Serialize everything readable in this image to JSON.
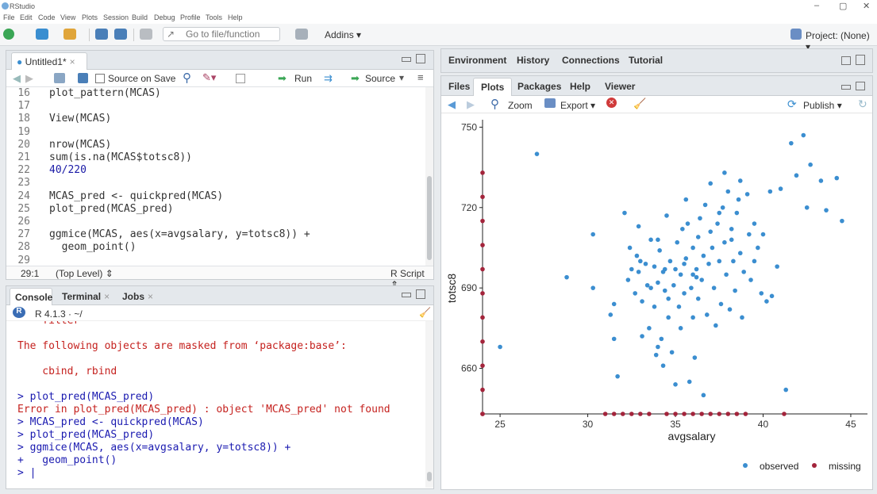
{
  "window": {
    "title": "RStudio",
    "minimize": "–",
    "maximize": "▢",
    "close": "✕"
  },
  "menu": [
    "File",
    "Edit",
    "Code",
    "View",
    "Plots",
    "Session",
    "Build",
    "Debug",
    "Profile",
    "Tools",
    "Help"
  ],
  "toolbar": {
    "goto_placeholder": "Go to file/function",
    "addins": "Addins ▾",
    "project": "Project: (None) ▾"
  },
  "editor": {
    "tab_label": "Untitled1*",
    "source_on_save": "Source on Save",
    "run_label": "Run",
    "source_label": "Source",
    "lines": [
      {
        "n": "16",
        "t": "plot_pattern(MCAS)"
      },
      {
        "n": "17",
        "t": ""
      },
      {
        "n": "18",
        "t": "View(MCAS)"
      },
      {
        "n": "19",
        "t": ""
      },
      {
        "n": "20",
        "t": "nrow(MCAS)"
      },
      {
        "n": "21",
        "t": "sum(is.na(MCAS$totsc8))"
      },
      {
        "n": "22",
        "t": "40/220"
      },
      {
        "n": "23",
        "t": ""
      },
      {
        "n": "24",
        "t": "MCAS_pred <- quickpred(MCAS)"
      },
      {
        "n": "25",
        "t": "plot_pred(MCAS_pred)"
      },
      {
        "n": "26",
        "t": ""
      },
      {
        "n": "27",
        "t": "ggmice(MCAS, aes(x=avgsalary, y=totsc8)) +"
      },
      {
        "n": "28",
        "t": "  geom_point()"
      },
      {
        "n": "29",
        "t": ""
      }
    ],
    "status_pos": "29:1",
    "status_scope": "(Top Level) ⇕",
    "status_type": "R Script ⇕"
  },
  "console": {
    "tabs": [
      "Console",
      "Terminal",
      "Jobs"
    ],
    "version": "R 4.1.3 · ~/",
    "lines": [
      {
        "t": "    filter",
        "c": "c-red"
      },
      {
        "t": "",
        "c": ""
      },
      {
        "t": "The following objects are masked from ‘package:base’:",
        "c": "c-red"
      },
      {
        "t": "",
        "c": ""
      },
      {
        "t": "    cbind, rbind",
        "c": "c-red"
      },
      {
        "t": "",
        "c": ""
      },
      {
        "t": "> plot_pred(MCAS_pred)",
        "c": "c-blue"
      },
      {
        "t": "Error in plot_pred(MCAS_pred) : object 'MCAS_pred' not found",
        "c": "c-red"
      },
      {
        "t": "> MCAS_pred <- quickpred(MCAS)",
        "c": "c-blue"
      },
      {
        "t": "> plot_pred(MCAS_pred)",
        "c": "c-blue"
      },
      {
        "t": "> ggmice(MCAS, aes(x=avgsalary, y=totsc8)) +",
        "c": "c-blue"
      },
      {
        "t": "+   geom_point()",
        "c": "c-blue"
      },
      {
        "t": "> |",
        "c": "c-blue"
      }
    ]
  },
  "env_tabs": [
    "Environment",
    "History",
    "Connections",
    "Tutorial"
  ],
  "files_tabs": [
    "Files",
    "Plots",
    "Packages",
    "Help",
    "Viewer"
  ],
  "plots_toolbar": {
    "zoom": "Zoom",
    "export": "Export ▾",
    "publish": "Publish ▾"
  },
  "colors": {
    "observed": "#3b8ed0",
    "missing": "#a3243b"
  },
  "chart_data": {
    "type": "scatter",
    "xlabel": "avgsalary",
    "ylabel": "totsc8",
    "xlim": [
      24,
      45.5
    ],
    "ylim": [
      643,
      751
    ],
    "x_ticks": [
      25,
      30,
      35,
      40,
      45
    ],
    "y_ticks": [
      660,
      690,
      720,
      750
    ],
    "legend": [
      {
        "name": "observed",
        "color": "#3b8ed0"
      },
      {
        "name": "missing",
        "color": "#a3243b"
      }
    ],
    "legend_position": "bottom-right",
    "observed": [
      [
        25,
        668
      ],
      [
        27.1,
        740
      ],
      [
        28.8,
        694
      ],
      [
        30.3,
        710
      ],
      [
        30.3,
        690
      ],
      [
        31.3,
        680
      ],
      [
        31.5,
        671
      ],
      [
        31.7,
        657
      ],
      [
        32.1,
        718
      ],
      [
        32.3,
        693
      ],
      [
        32.5,
        697
      ],
      [
        32.7,
        688
      ],
      [
        32.8,
        702
      ],
      [
        32.9,
        713
      ],
      [
        32.9,
        696
      ],
      [
        33.1,
        672
      ],
      [
        33.1,
        685
      ],
      [
        33.3,
        699
      ],
      [
        33.4,
        691
      ],
      [
        33.5,
        675
      ],
      [
        33.6,
        708
      ],
      [
        33.8,
        683
      ],
      [
        33.8,
        698
      ],
      [
        33.9,
        665
      ],
      [
        34,
        668
      ],
      [
        34,
        692
      ],
      [
        34.1,
        704
      ],
      [
        34.2,
        671
      ],
      [
        34.3,
        661
      ],
      [
        34.3,
        696
      ],
      [
        34.4,
        689
      ],
      [
        34.5,
        717
      ],
      [
        34.6,
        679
      ],
      [
        34.6,
        686
      ],
      [
        34.7,
        700
      ],
      [
        34.8,
        666
      ],
      [
        34.9,
        691
      ],
      [
        35,
        697
      ],
      [
        35,
        654
      ],
      [
        35.1,
        707
      ],
      [
        35.2,
        683
      ],
      [
        35.3,
        675
      ],
      [
        35.3,
        695
      ],
      [
        35.4,
        712
      ],
      [
        35.5,
        688
      ],
      [
        35.5,
        699
      ],
      [
        35.6,
        701
      ],
      [
        35.7,
        714
      ],
      [
        35.8,
        655
      ],
      [
        35.9,
        690
      ],
      [
        36,
        705
      ],
      [
        36,
        679
      ],
      [
        36.1,
        664
      ],
      [
        36.2,
        697
      ],
      [
        36.3,
        709
      ],
      [
        36.3,
        686
      ],
      [
        36.4,
        716
      ],
      [
        36.5,
        693
      ],
      [
        36.6,
        650
      ],
      [
        36.6,
        702
      ],
      [
        36.7,
        721
      ],
      [
        36.8,
        680
      ],
      [
        36.9,
        699
      ],
      [
        37,
        711
      ],
      [
        37,
        729
      ],
      [
        37.1,
        705
      ],
      [
        37.2,
        690
      ],
      [
        37.3,
        676
      ],
      [
        37.4,
        714
      ],
      [
        37.5,
        700
      ],
      [
        37.6,
        684
      ],
      [
        37.7,
        720
      ],
      [
        37.8,
        707
      ],
      [
        37.9,
        695
      ],
      [
        38,
        726
      ],
      [
        38.1,
        682
      ],
      [
        38.2,
        712
      ],
      [
        38.3,
        700
      ],
      [
        38.4,
        689
      ],
      [
        38.5,
        718
      ],
      [
        38.6,
        723
      ],
      [
        38.7,
        703
      ],
      [
        38.8,
        679
      ],
      [
        38.9,
        696
      ],
      [
        39.1,
        725
      ],
      [
        39.2,
        710
      ],
      [
        39.3,
        693
      ],
      [
        39.5,
        714
      ],
      [
        39.7,
        705
      ],
      [
        39.9,
        688
      ],
      [
        40.2,
        685
      ],
      [
        40.4,
        726
      ],
      [
        40.8,
        698
      ],
      [
        41,
        727
      ],
      [
        41.3,
        652
      ],
      [
        41.6,
        744
      ],
      [
        41.9,
        732
      ],
      [
        42.3,
        747
      ],
      [
        42.5,
        720
      ],
      [
        42.7,
        736
      ],
      [
        43.3,
        730
      ],
      [
        43.6,
        719
      ],
      [
        44.2,
        731
      ],
      [
        44.5,
        715
      ],
      [
        34.4,
        697
      ],
      [
        33,
        700
      ],
      [
        33.6,
        690
      ],
      [
        36.2,
        694
      ],
      [
        35.6,
        723
      ],
      [
        37.5,
        718
      ],
      [
        37.8,
        733
      ],
      [
        38.7,
        730
      ],
      [
        40,
        710
      ],
      [
        38.2,
        708
      ],
      [
        36,
        695
      ],
      [
        34,
        708
      ],
      [
        31.5,
        684
      ],
      [
        32.4,
        705
      ],
      [
        39.5,
        700
      ],
      [
        40.5,
        687
      ]
    ],
    "missing_x": [
      24,
      31,
      31.5,
      32,
      32.5,
      33,
      33.5,
      34.5,
      35,
      35.5,
      36,
      36.5,
      37,
      37.5,
      38,
      38.5,
      39,
      41.2
    ],
    "missing_y": [
      643,
      652,
      661,
      670,
      679,
      688,
      697,
      706,
      715,
      724,
      733
    ]
  }
}
